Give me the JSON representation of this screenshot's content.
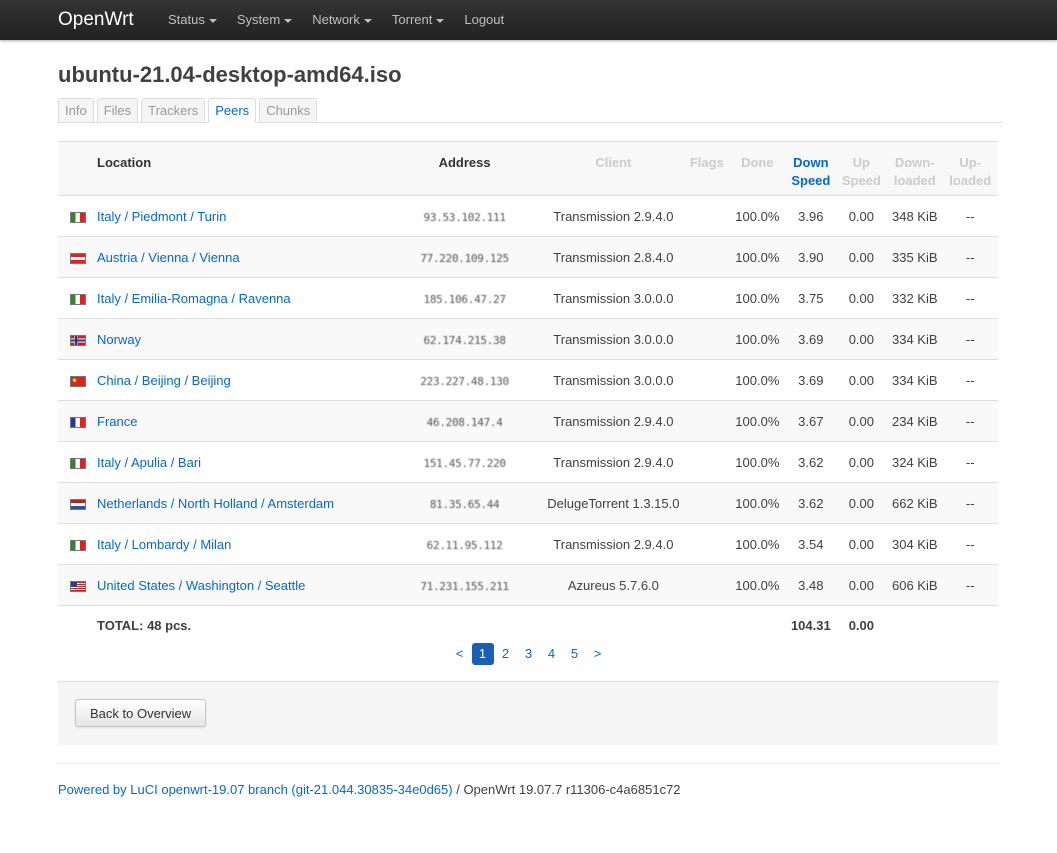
{
  "nav": {
    "brand": "OpenWrt",
    "menu": [
      {
        "label": "Status",
        "dropdown": true
      },
      {
        "label": "System",
        "dropdown": true
      },
      {
        "label": "Network",
        "dropdown": true
      },
      {
        "label": "Torrent",
        "dropdown": true
      },
      {
        "label": "Logout",
        "dropdown": false
      }
    ]
  },
  "page": {
    "title": "ubuntu-21.04-desktop-amd64.iso"
  },
  "tabs": [
    {
      "label": "Info",
      "active": false
    },
    {
      "label": "Files",
      "active": false
    },
    {
      "label": "Trackers",
      "active": false
    },
    {
      "label": "Peers",
      "active": true
    },
    {
      "label": "Chunks",
      "active": false
    }
  ],
  "table": {
    "headers": {
      "location": "Location",
      "address": "Address",
      "client": "Client",
      "flags": "Flags",
      "done": "Done",
      "down_speed_1": "Down",
      "down_speed_2": "Speed",
      "up_speed_1": "Up",
      "up_speed_2": "Speed",
      "downloaded_1": "Down-",
      "downloaded_2": "loaded",
      "uploaded_1": "Up-",
      "uploaded_2": "loaded"
    },
    "rows": [
      {
        "flag": "it",
        "location": "Italy / Piedmont / Turin",
        "address": "93.53.102.111",
        "client": "Transmission 2.9.4.0",
        "flags": "",
        "done": "100.0%",
        "down": "3.96",
        "up": "0.00",
        "downloaded": "348 KiB",
        "uploaded": "--"
      },
      {
        "flag": "at",
        "location": "Austria / Vienna / Vienna",
        "address": "77.220.109.125",
        "client": "Transmission 2.8.4.0",
        "flags": "",
        "done": "100.0%",
        "down": "3.90",
        "up": "0.00",
        "downloaded": "335 KiB",
        "uploaded": "--"
      },
      {
        "flag": "it",
        "location": "Italy / Emilia-Romagna / Ravenna",
        "address": "185.106.47.27",
        "client": "Transmission 3.0.0.0",
        "flags": "",
        "done": "100.0%",
        "down": "3.75",
        "up": "0.00",
        "downloaded": "332 KiB",
        "uploaded": "--"
      },
      {
        "flag": "no",
        "location": "Norway",
        "address": "62.174.215.38",
        "client": "Transmission 3.0.0.0",
        "flags": "",
        "done": "100.0%",
        "down": "3.69",
        "up": "0.00",
        "downloaded": "334 KiB",
        "uploaded": "--"
      },
      {
        "flag": "cn",
        "location": "China / Beijing / Beijing",
        "address": "223.227.48.130",
        "client": "Transmission 3.0.0.0",
        "flags": "",
        "done": "100.0%",
        "down": "3.69",
        "up": "0.00",
        "downloaded": "334 KiB",
        "uploaded": "--"
      },
      {
        "flag": "fr",
        "location": "France",
        "address": "46.208.147.4",
        "client": "Transmission 2.9.4.0",
        "flags": "",
        "done": "100.0%",
        "down": "3.67",
        "up": "0.00",
        "downloaded": "234 KiB",
        "uploaded": "--"
      },
      {
        "flag": "it",
        "location": "Italy / Apulia / Bari",
        "address": "151.45.77.220",
        "client": "Transmission 2.9.4.0",
        "flags": "",
        "done": "100.0%",
        "down": "3.62",
        "up": "0.00",
        "downloaded": "324 KiB",
        "uploaded": "--"
      },
      {
        "flag": "nl",
        "location": "Netherlands / North Holland / Amsterdam",
        "address": "81.35.65.44",
        "client": "DelugeTorrent 1.3.15.0",
        "flags": "",
        "done": "100.0%",
        "down": "3.62",
        "up": "0.00",
        "downloaded": "662 KiB",
        "uploaded": "--"
      },
      {
        "flag": "it",
        "location": "Italy / Lombardy / Milan",
        "address": "62.11.95.112",
        "client": "Transmission 2.9.4.0",
        "flags": "",
        "done": "100.0%",
        "down": "3.54",
        "up": "0.00",
        "downloaded": "304 KiB",
        "uploaded": "--"
      },
      {
        "flag": "us",
        "location": "United States / Washington / Seattle",
        "address": "71.231.155.211",
        "client": "Azureus 5.7.6.0",
        "flags": "",
        "done": "100.0%",
        "down": "3.48",
        "up": "0.00",
        "downloaded": "606 KiB",
        "uploaded": "--"
      }
    ],
    "total": {
      "label": "TOTAL: 48 pcs.",
      "down": "104.31",
      "up": "0.00"
    }
  },
  "pager": {
    "prev": "<",
    "pages": [
      "1",
      "2",
      "3",
      "4",
      "5"
    ],
    "current": "1",
    "next": ">"
  },
  "actions": {
    "back_label": "Back to Overview"
  },
  "footer": {
    "link_text": "Powered by LuCI openwrt-19.07 branch (git-21.044.30835-34e0d65)",
    "version_text": " / OpenWrt 19.07.7 r11306-c4a6851c72"
  }
}
